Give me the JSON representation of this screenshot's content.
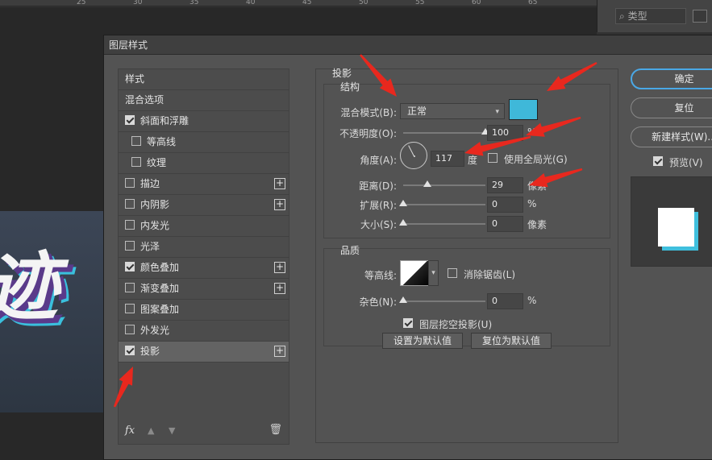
{
  "ruler": {
    "marks": [
      "25",
      "30",
      "35",
      "40",
      "45",
      "50",
      "55",
      "60",
      "65"
    ]
  },
  "layers_panel": {
    "search_placeholder": "类型"
  },
  "canvas": {
    "art_text": "迹"
  },
  "dialog": {
    "title": "图层样式",
    "style_list": {
      "header": "样式",
      "items": [
        {
          "label": "混合选项",
          "checkbox": false,
          "checked": false,
          "plus": false,
          "indent": false,
          "active": false
        },
        {
          "label": "斜面和浮雕",
          "checkbox": true,
          "checked": true,
          "plus": false,
          "indent": false,
          "active": false
        },
        {
          "label": "等高线",
          "checkbox": true,
          "checked": false,
          "plus": false,
          "indent": true,
          "active": false
        },
        {
          "label": "纹理",
          "checkbox": true,
          "checked": false,
          "plus": false,
          "indent": true,
          "active": false
        },
        {
          "label": "描边",
          "checkbox": true,
          "checked": false,
          "plus": true,
          "indent": false,
          "active": false
        },
        {
          "label": "内阴影",
          "checkbox": true,
          "checked": false,
          "plus": true,
          "indent": false,
          "active": false
        },
        {
          "label": "内发光",
          "checkbox": true,
          "checked": false,
          "plus": false,
          "indent": false,
          "active": false
        },
        {
          "label": "光泽",
          "checkbox": true,
          "checked": false,
          "plus": false,
          "indent": false,
          "active": false
        },
        {
          "label": "颜色叠加",
          "checkbox": true,
          "checked": true,
          "plus": true,
          "indent": false,
          "active": false
        },
        {
          "label": "渐变叠加",
          "checkbox": true,
          "checked": false,
          "plus": true,
          "indent": false,
          "active": false
        },
        {
          "label": "图案叠加",
          "checkbox": true,
          "checked": false,
          "plus": false,
          "indent": false,
          "active": false
        },
        {
          "label": "外发光",
          "checkbox": true,
          "checked": false,
          "plus": false,
          "indent": false,
          "active": false
        },
        {
          "label": "投影",
          "checkbox": true,
          "checked": true,
          "plus": true,
          "indent": false,
          "active": true
        }
      ],
      "footer": {
        "fx": "fx"
      }
    },
    "drop_shadow": {
      "title": "投影",
      "structure": {
        "title": "结构",
        "blend_mode_label": "混合模式(B):",
        "blend_mode_value": "正常",
        "shadow_color": "#3fb8d9",
        "opacity_label": "不透明度(O):",
        "opacity_value": "100",
        "opacity_unit": "%",
        "opacity_level": 1.0,
        "angle_label": "角度(A):",
        "angle_value": "117",
        "angle_unit": "度",
        "global_light_label": "使用全局光(G)",
        "global_light_checked": false,
        "distance_label": "距离(D):",
        "distance_value": "29",
        "distance_unit": "像素",
        "distance_level": 0.29,
        "spread_label": "扩展(R):",
        "spread_value": "0",
        "spread_unit": "%",
        "spread_level": 0,
        "size_label": "大小(S):",
        "size_value": "0",
        "size_unit": "像素",
        "size_level": 0
      },
      "quality": {
        "title": "品质",
        "contour_label": "等高线:",
        "antialias_label": "消除锯齿(L)",
        "antialias_checked": false,
        "noise_label": "杂色(N):",
        "noise_value": "0",
        "noise_unit": "%",
        "noise_level": 0
      },
      "knockout_label": "图层挖空投影(U)",
      "knockout_checked": true,
      "set_default_label": "设置为默认值",
      "reset_default_label": "复位为默认值"
    },
    "buttons": {
      "ok": "确定",
      "reset": "复位",
      "new_style": "新建样式(W)...",
      "preview_label": "预览(V)",
      "preview_checked": true
    }
  },
  "colors": {
    "accent": "#4aa8e6",
    "annotation": "#e8281e",
    "shadow": "#3fb8d9"
  }
}
